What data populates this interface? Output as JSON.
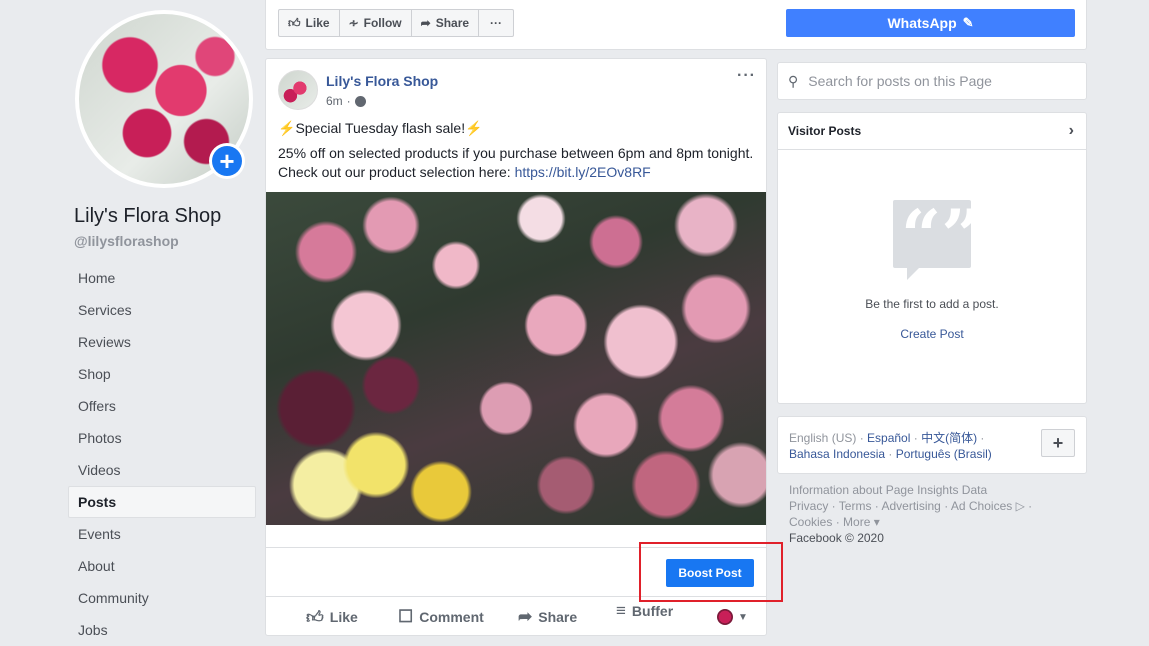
{
  "profile": {
    "name": "Lily's Flora Shop",
    "handle": "@lilysflorashop",
    "add_icon": "+"
  },
  "nav": {
    "items": [
      "Home",
      "Services",
      "Reviews",
      "Shop",
      "Offers",
      "Photos",
      "Videos",
      "Posts",
      "Events",
      "About",
      "Community",
      "Jobs"
    ],
    "active": "Posts"
  },
  "topbar": {
    "like_label": "Like",
    "follow_label": "Follow",
    "share_label": "Share",
    "more_label": "···",
    "whatsapp_label": "WhatsApp"
  },
  "post": {
    "author": "Lily's Flora Shop",
    "time": "6m",
    "separator": "·",
    "more_label": "···",
    "line1": "Special Tuesday flash sale!",
    "bolt": "⚡",
    "line2": "25% off on selected products if you purchase between 6pm and 8pm tonight. Check out our product selection here: ",
    "link": "https://bit.ly/2EOv8RF",
    "boost_label": "Boost Post",
    "actions": {
      "like": "Like",
      "comment": "Comment",
      "share": "Share",
      "buffer": "Buffer"
    }
  },
  "search": {
    "placeholder": "Search for posts on this Page"
  },
  "visitor_posts": {
    "title": "Visitor Posts",
    "empty_text": "Be the first to add a post.",
    "create_label": "Create Post"
  },
  "languages": {
    "current": "English (US)",
    "sep": " · ",
    "espanol": "Español",
    "chinese": "中文(简体)",
    "indonesia": "Bahasa Indonesia",
    "portugues": "Português (Brasil)",
    "add_label": "+"
  },
  "footer": {
    "line1": "Information about Page Insights Data",
    "privacy": "Privacy",
    "terms": "Terms",
    "advertising": "Advertising",
    "ad_choices": "Ad Choices",
    "cookies": "Cookies",
    "more": "More",
    "copyright": "Facebook © 2020"
  },
  "colors": {
    "brand_blue": "#1877f2",
    "link_blue": "#385898",
    "highlight_red": "#e0202a"
  }
}
